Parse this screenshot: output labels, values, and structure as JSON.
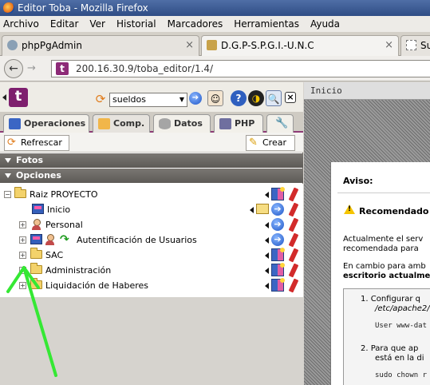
{
  "window": {
    "title": "Editor Toba - Mozilla Firefox"
  },
  "menu": [
    "Archivo",
    "Editar",
    "Ver",
    "Historial",
    "Marcadores",
    "Herramientas",
    "Ayuda"
  ],
  "browser_tabs": [
    {
      "label": "phpPgAdmin",
      "close": "×"
    },
    {
      "label": "D.G.P-S.P.G.I.-U.N.C",
      "close": "×"
    },
    {
      "label": "Su"
    }
  ],
  "nav": {
    "back": "←",
    "forward": "→",
    "url": "200.16.30.9/toba_editor/1.4/"
  },
  "panel": {
    "logo": "t",
    "project_select": "sueldos",
    "tabs": [
      "Operaciones",
      "Comp.",
      "Datos",
      "PHP"
    ],
    "actions": {
      "refresh": "Refrescar",
      "create": "Crear"
    },
    "sections": {
      "fotos": "Fotos",
      "opciones": "Opciones"
    },
    "tree": [
      {
        "label": "Raiz PROYECTO",
        "expander": "−"
      },
      {
        "label": "Inicio"
      },
      {
        "label": "Personal",
        "expander": "+"
      },
      {
        "label": "Autentificación de Usuarios",
        "expander": "+"
      },
      {
        "label": "SAC",
        "expander": "+"
      },
      {
        "label": "Administración",
        "expander": "+"
      },
      {
        "label": "Liquidación de Haberes",
        "expander": "+"
      }
    ]
  },
  "content": {
    "header": "Inicio",
    "aviso": "Aviso:",
    "recommended": "Recomendado c",
    "p1_line1": "Actualmente el serv",
    "p1_line2": "recomendada para",
    "p2_line1": "En cambio para amb",
    "p2_line2": "escritorio actualme",
    "step1": "1. Configurar q",
    "step1_path": "/etc/apache2/",
    "step1_code": "User www-dat",
    "step2_line1": "2. Para que ap",
    "step2_line2": "está en la di",
    "step2_code": "sudo chown r"
  },
  "colors": {
    "toba_brand": "#7e1f6e",
    "annotation": "#35e834"
  }
}
